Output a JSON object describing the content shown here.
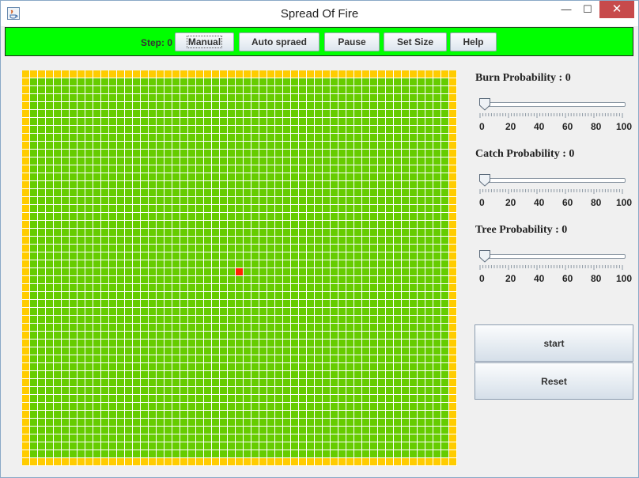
{
  "window": {
    "title": "Spread Of Fire",
    "minimize_glyph": "—",
    "maximize_glyph": "☐",
    "close_glyph": "✕",
    "app_icon": "java-icon"
  },
  "toolbar": {
    "step_label": "Step: 0",
    "buttons": [
      "Manual",
      "Auto spraed",
      "Pause",
      "Set Size",
      "Help"
    ],
    "background_color": "#00ff00"
  },
  "forest": {
    "tree_color": "#66cc00",
    "border_color": "#ffcc00",
    "fire_color": "#ff2200"
  },
  "sliders": [
    {
      "label": "Burn Probability : 0",
      "value": 0
    },
    {
      "label": "Catch Probability : 0",
      "value": 0
    },
    {
      "label": "Tree Probability : 0",
      "value": 0
    }
  ],
  "slider_tick_labels": [
    "0",
    "20",
    "40",
    "60",
    "80",
    "100"
  ],
  "actions": {
    "start": "start",
    "reset": "Reset"
  }
}
